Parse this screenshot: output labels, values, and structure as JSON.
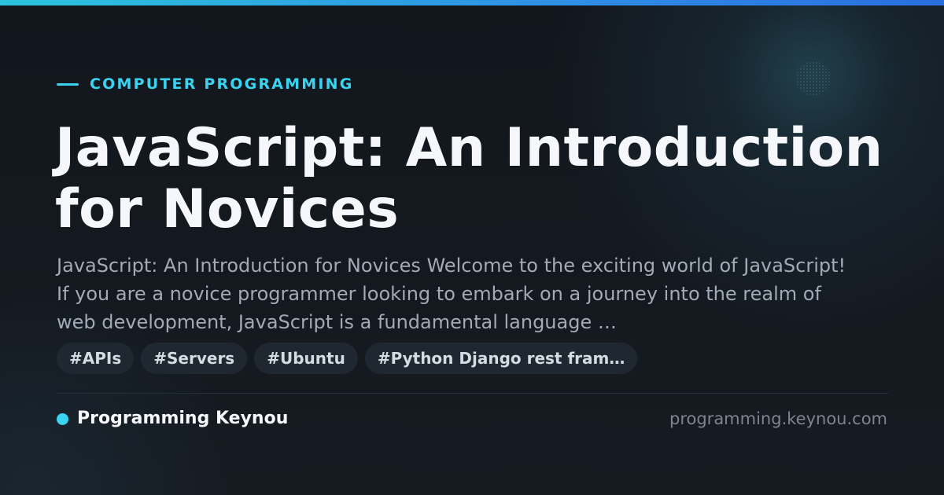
{
  "theme": {
    "accent": "#3ad3f0",
    "background": "#14181f"
  },
  "category": {
    "label": "COMPUTER PROGRAMMING"
  },
  "article": {
    "title": "JavaScript: An Introduction for Novices",
    "excerpt": "JavaScript: An Introduction for Novices Welcome to the exciting world of JavaScript! If you are a novice programmer looking to embark on a journey into the realm of web development, JavaScript is a fundamental language …"
  },
  "tags": [
    "#APIs",
    "#Servers",
    "#Ubuntu",
    "#Python Django rest fram…"
  ],
  "footer": {
    "brand_name": "Programming Keynou",
    "domain": "programming.keynou.com"
  }
}
